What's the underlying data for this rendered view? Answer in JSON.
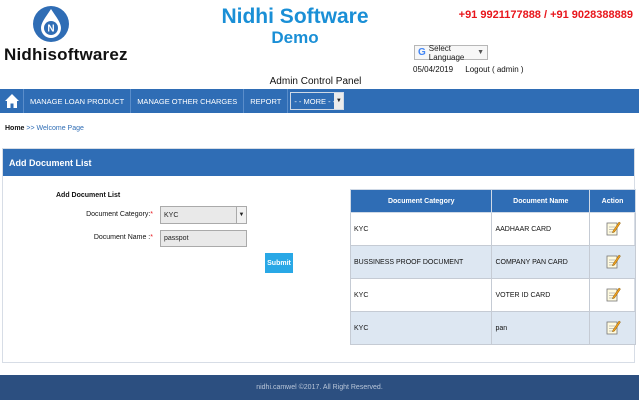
{
  "header": {
    "brand": "Nidhisoftwarez",
    "title": "Nidhi Software",
    "subtitle": "Demo",
    "phones": "+91 9921177888 / +91 9028388889",
    "language_label": "Select Language",
    "date": "05/04/2019",
    "logout": "Logout ( admin )",
    "panel_title": "Admin Control Panel"
  },
  "nav": {
    "items": [
      "MANAGE LOAN PRODUCT",
      "MANAGE OTHER CHARGES",
      "REPORT"
    ],
    "more": "- - MORE - -"
  },
  "breadcrumb": {
    "home": "Home",
    "sep": ">>",
    "current": "Welcome Page"
  },
  "card": {
    "title": "Add Document List",
    "form_title": "Add Document List",
    "category_label": "Document Category:",
    "category_value": "KYC",
    "name_label": "Document Name :",
    "name_value": "passpot",
    "required_mark": "*",
    "submit": "Submit"
  },
  "table": {
    "headers": [
      "Document Category",
      "Document Name",
      "Action"
    ],
    "rows": [
      {
        "category": "KYC",
        "name": "AADHAAR CARD"
      },
      {
        "category": "BUSSINESS PROOF DOCUMENT",
        "name": "COMPANY PAN CARD"
      },
      {
        "category": "KYC",
        "name": "VOTER ID CARD"
      },
      {
        "category": "KYC",
        "name": "pan"
      }
    ]
  },
  "footer": "nidhi.camwel ©2017. All Right Reserved.",
  "colors": {
    "primary": "#2f6db5",
    "title_blue": "#1a8fd6",
    "phone_red": "#e8151b",
    "submit": "#29a8e6",
    "footer": "#2c4f80"
  }
}
